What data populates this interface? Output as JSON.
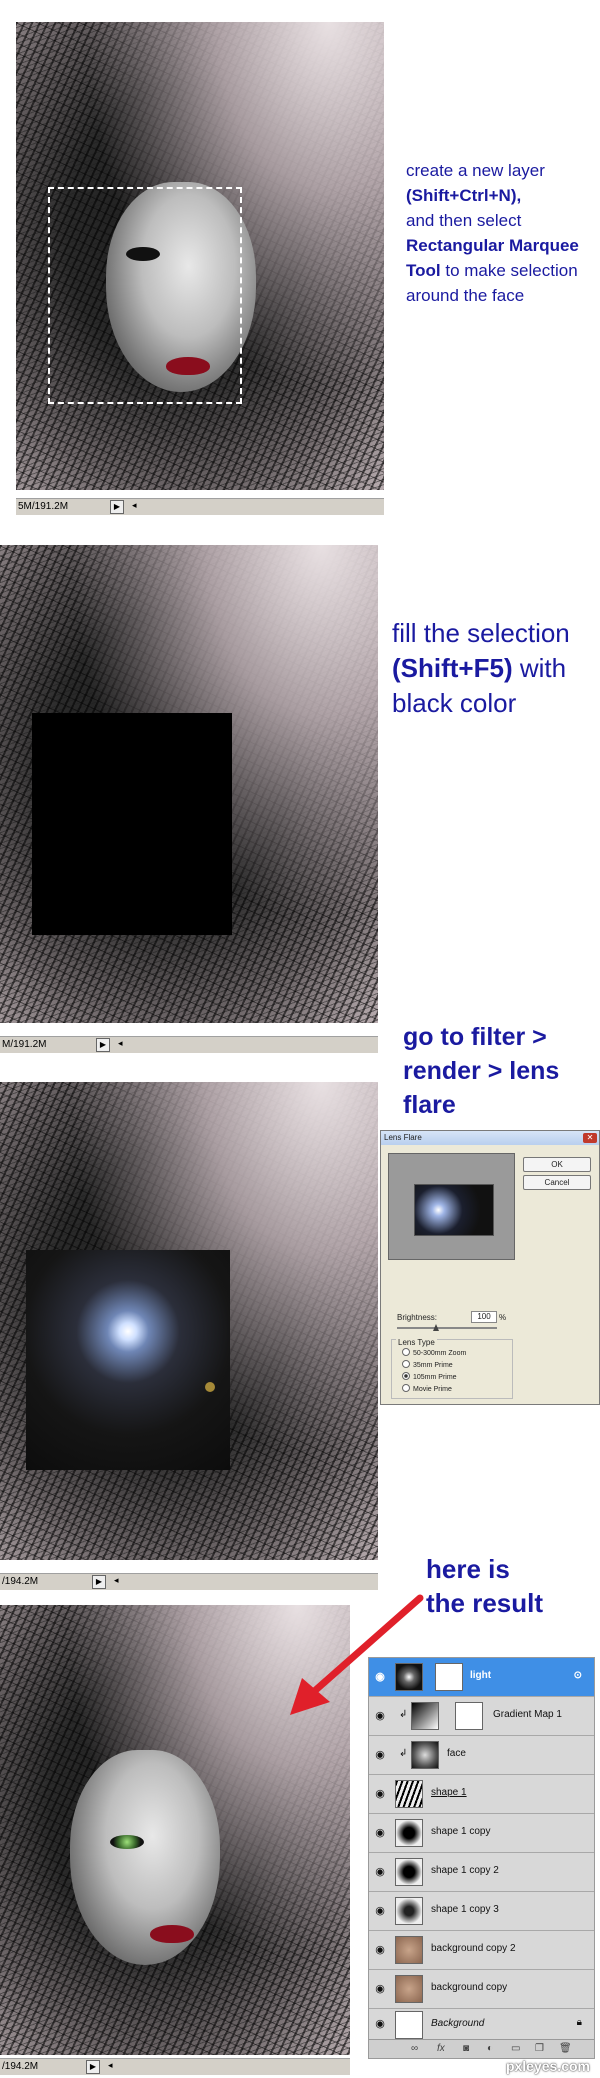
{
  "steps": {
    "step1": {
      "text_plain1": "create a new layer",
      "text_bold1": "(Shift+Ctrl+N),",
      "text_plain2": "and then select",
      "text_bold2": "Rectangular Marquee Tool",
      "text_plain3": "to make selection around the face",
      "status": "5M/191.2M"
    },
    "step2": {
      "text_plain1": "fill the selection",
      "text_bold1": "(Shift+F5)",
      "text_plain2": "with black color",
      "status": "M/191.2M"
    },
    "step3": {
      "text_plain1": "go to",
      "text_bold1": "filter > render > lens flare",
      "status": "/194.2M",
      "dialog": {
        "title": "Lens Flare",
        "ok_label": "OK",
        "cancel_label": "Cancel",
        "brightness_label": "Brightness:",
        "brightness_value": "100",
        "brightness_unit": "%",
        "lens_type_label": "Lens Type",
        "options": [
          "50-300mm Zoom",
          "35mm Prime",
          "105mm Prime",
          "Movie Prime"
        ],
        "selected_option": "105mm Prime"
      }
    },
    "step4": {
      "text1": "here is",
      "text2": "the result",
      "status": "/194.2M",
      "layers": [
        {
          "name": "light",
          "selected": true
        },
        {
          "name": "Gradient Map 1",
          "selected": false
        },
        {
          "name": "face",
          "selected": false
        },
        {
          "name": "shape 1",
          "selected": false
        },
        {
          "name": "shape 1 copy",
          "selected": false
        },
        {
          "name": "shape 1 copy 2",
          "selected": false
        },
        {
          "name": "shape 1 copy 3",
          "selected": false
        },
        {
          "name": "background copy 2",
          "selected": false
        },
        {
          "name": "background copy",
          "selected": false
        },
        {
          "name": "Background",
          "selected": false
        }
      ],
      "footer_icons": [
        "link-icon",
        "fx-icon",
        "mask-icon",
        "adjustment-icon",
        "folder-icon",
        "new-layer-icon",
        "trash-icon"
      ],
      "watermark": "pxleyes.com"
    }
  },
  "colors": {
    "instruction_text": "#1a1aa0",
    "selected_layer": "#3f8fe6",
    "arrow": "#e0202a"
  }
}
